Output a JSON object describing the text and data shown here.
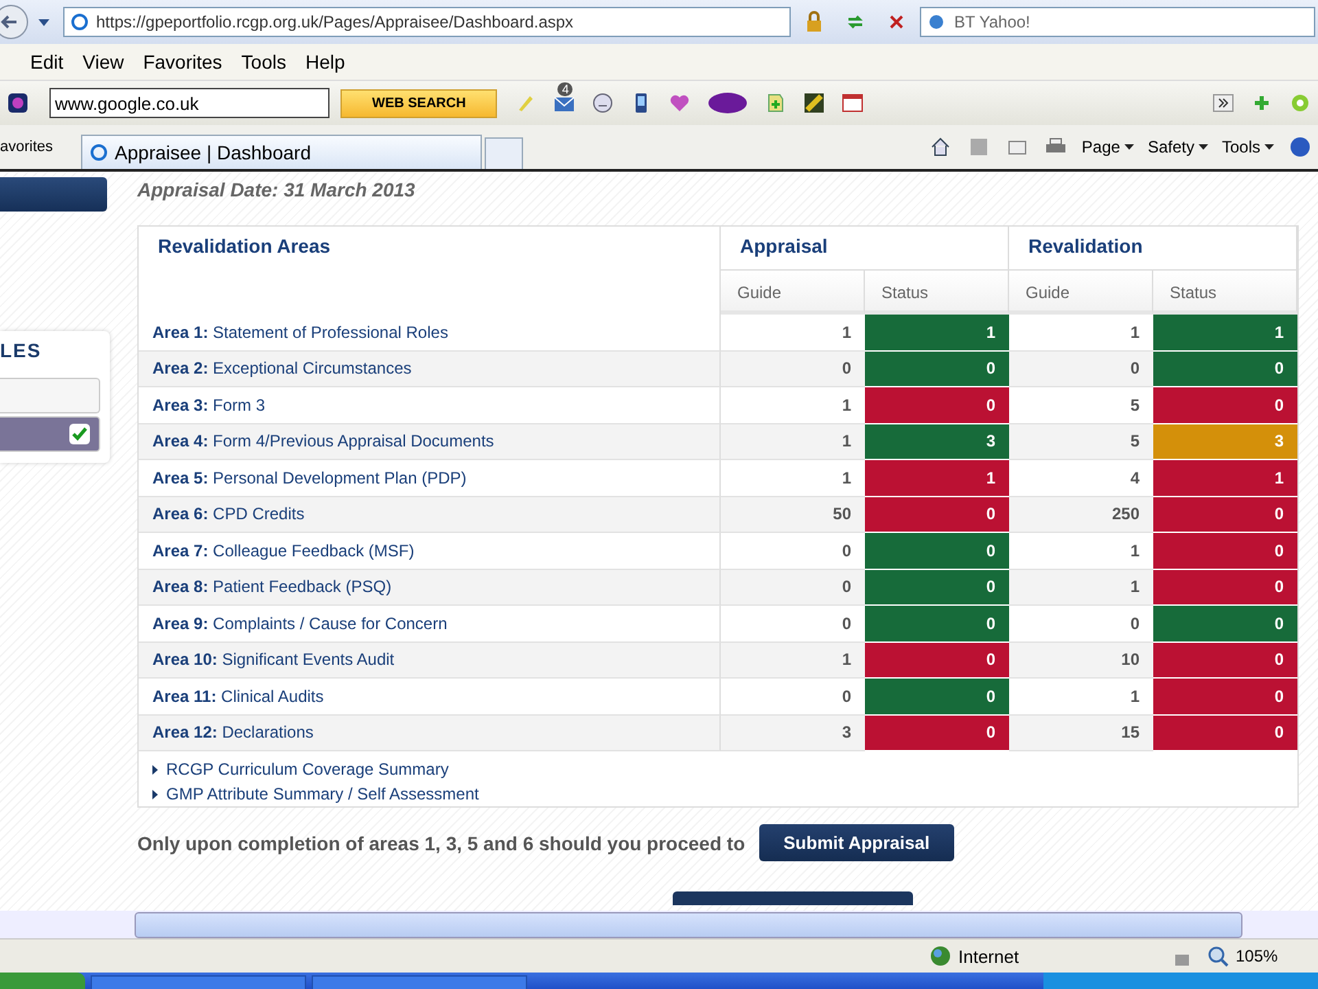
{
  "browser": {
    "address": "https://gpeportfolio.rcgp.org.uk/Pages/Appraisee/Dashboard.aspx",
    "search_box": "BT Yahoo!",
    "menu": [
      "Edit",
      "View",
      "Favorites",
      "Tools",
      "Help"
    ],
    "toolbar_search": "www.google.co.uk",
    "web_search_button": "WEB SEARCH",
    "mail_badge": "4",
    "favorites_label": "avorites",
    "tab_title": "Appraisee | Dashboard",
    "command_bar": [
      "Page",
      "Safety",
      "Tools"
    ]
  },
  "sidebar": {
    "panel_title": "LES",
    "items": [
      {
        "checked": false
      },
      {
        "checked": true
      }
    ]
  },
  "appraisal_date": "Appraisal Date: 31 March 2013",
  "table": {
    "area_heading": "Revalidation Areas",
    "groups": [
      "Appraisal",
      "Revalidation"
    ],
    "subheadings": [
      "Guide",
      "Status",
      "Guide",
      "Status"
    ],
    "rows": [
      {
        "label": "Area 1:",
        "title": "Statement of Professional Roles",
        "cells": [
          {
            "guide": "1",
            "status": "1",
            "color": "#176b3a"
          },
          {
            "guide": "1",
            "status": "1",
            "color": "#176b3a"
          }
        ]
      },
      {
        "label": "Area 2:",
        "title": "Exceptional Circumstances",
        "cells": [
          {
            "guide": "0",
            "status": "0",
            "color": "#176b3a"
          },
          {
            "guide": "0",
            "status": "0",
            "color": "#176b3a"
          }
        ]
      },
      {
        "label": "Area 3:",
        "title": "Form 3",
        "cells": [
          {
            "guide": "1",
            "status": "0",
            "color": "#bb1133"
          },
          {
            "guide": "5",
            "status": "0",
            "color": "#bb1133"
          }
        ]
      },
      {
        "label": "Area 4:",
        "title": "Form 4/Previous Appraisal Documents",
        "cells": [
          {
            "guide": "1",
            "status": "3",
            "color": "#176b3a"
          },
          {
            "guide": "5",
            "status": "3",
            "color": "#d4900a"
          }
        ]
      },
      {
        "label": "Area 5:",
        "title": "Personal Development Plan (PDP)",
        "cells": [
          {
            "guide": "1",
            "status": "1",
            "color": "#bb1133"
          },
          {
            "guide": "4",
            "status": "1",
            "color": "#bb1133"
          }
        ]
      },
      {
        "label": "Area 6:",
        "title": "CPD Credits",
        "cells": [
          {
            "guide": "50",
            "status": "0",
            "color": "#bb1133"
          },
          {
            "guide": "250",
            "status": "0",
            "color": "#bb1133"
          }
        ]
      },
      {
        "label": "Area 7:",
        "title": "Colleague Feedback (MSF)",
        "cells": [
          {
            "guide": "0",
            "status": "0",
            "color": "#176b3a"
          },
          {
            "guide": "1",
            "status": "0",
            "color": "#bb1133"
          }
        ]
      },
      {
        "label": "Area 8:",
        "title": "Patient Feedback (PSQ)",
        "cells": [
          {
            "guide": "0",
            "status": "0",
            "color": "#176b3a"
          },
          {
            "guide": "1",
            "status": "0",
            "color": "#bb1133"
          }
        ]
      },
      {
        "label": "Area 9:",
        "title": "Complaints / Cause for Concern",
        "cells": [
          {
            "guide": "0",
            "status": "0",
            "color": "#176b3a"
          },
          {
            "guide": "0",
            "status": "0",
            "color": "#176b3a"
          }
        ]
      },
      {
        "label": "Area 10:",
        "title": "Significant Events Audit",
        "cells": [
          {
            "guide": "1",
            "status": "0",
            "color": "#bb1133"
          },
          {
            "guide": "10",
            "status": "0",
            "color": "#bb1133"
          }
        ]
      },
      {
        "label": "Area 11:",
        "title": "Clinical Audits",
        "cells": [
          {
            "guide": "0",
            "status": "0",
            "color": "#176b3a"
          },
          {
            "guide": "1",
            "status": "0",
            "color": "#bb1133"
          }
        ]
      },
      {
        "label": "Area 12:",
        "title": "Declarations",
        "cells": [
          {
            "guide": "3",
            "status": "0",
            "color": "#bb1133"
          },
          {
            "guide": "15",
            "status": "0",
            "color": "#bb1133"
          }
        ]
      }
    ],
    "links": [
      "RCGP Curriculum Coverage Summary",
      "GMP Attribute Summary / Self Assessment"
    ]
  },
  "submit_note": "Only upon completion of areas 1, 3, 5 and 6 should you proceed to",
  "submit_button": "Submit Appraisal",
  "status_bar": {
    "zone": "Internet",
    "zoom": "105%"
  }
}
